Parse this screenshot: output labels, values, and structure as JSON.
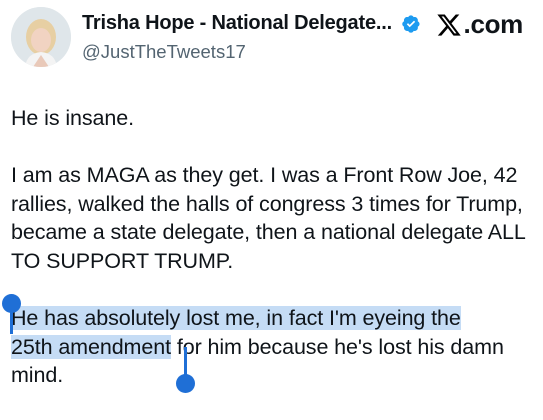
{
  "header": {
    "display_name": "Trisha Hope - National Delegate...",
    "handle": "@JustTheTweets17",
    "brand": {
      "logo_icon": "x-logo-icon",
      "suffix": ".com"
    },
    "verified_icon": "verified-badge-icon"
  },
  "tweet": {
    "paragraphs": [
      "He is insane.",
      "I am as MAGA as they get.  I was a Front Row Joe, 42 rallies, walked the halls of congress 3 times for Trump, became a state delegate, then a national delegate ALL TO SUPPORT TRUMP."
    ],
    "selected_text_line1": "He has absolutely lost me, in fact I'm eyeing the",
    "selected_text_line2": "25th amendment",
    "unselected_tail": " for him because he's lost his damn mind."
  },
  "colors": {
    "selection_highlight": "#c5dcf5",
    "selection_handle": "#1f6fd6",
    "verified_blue": "#1d9bf0",
    "handle_gray": "#536471"
  }
}
